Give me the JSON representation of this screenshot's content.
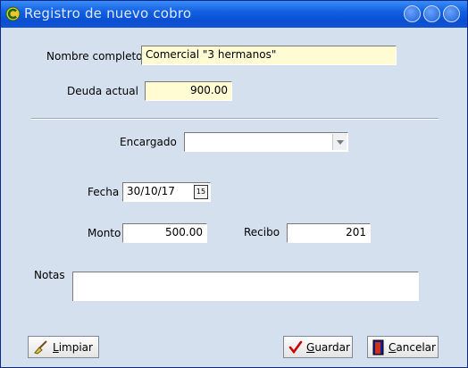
{
  "window": {
    "title": "Registro de nuevo cobro"
  },
  "form": {
    "nombre_label": "Nombre completo",
    "nombre_value": "Comercial \"3 hermanos\"",
    "deuda_label": "Deuda actual",
    "deuda_value": "900.00",
    "encargado_label": "Encargado",
    "encargado_value": "",
    "fecha_label": "Fecha",
    "fecha_value": "30/10/17",
    "fecha_btn": "15",
    "monto_label": "Monto",
    "monto_value": "500.00",
    "recibo_label": "Recibo",
    "recibo_value": "201",
    "notas_label": "Notas",
    "notas_value": ""
  },
  "buttons": {
    "limpiar_first": "L",
    "limpiar_rest": "impiar",
    "guardar_first": "G",
    "guardar_rest": "uardar",
    "cancelar_first": "C",
    "cancelar_rest": "ancelar"
  },
  "icons": {
    "app": "app-c-icon",
    "limpiar": "broom-icon",
    "guardar": "checkmark-icon",
    "cancelar": "door-exit-icon"
  },
  "colors": {
    "titlebar": "#0a4fd0",
    "window_bg": "#d4e0ee",
    "highlight_field": "#fffbd2",
    "check_red": "#cc0000"
  }
}
